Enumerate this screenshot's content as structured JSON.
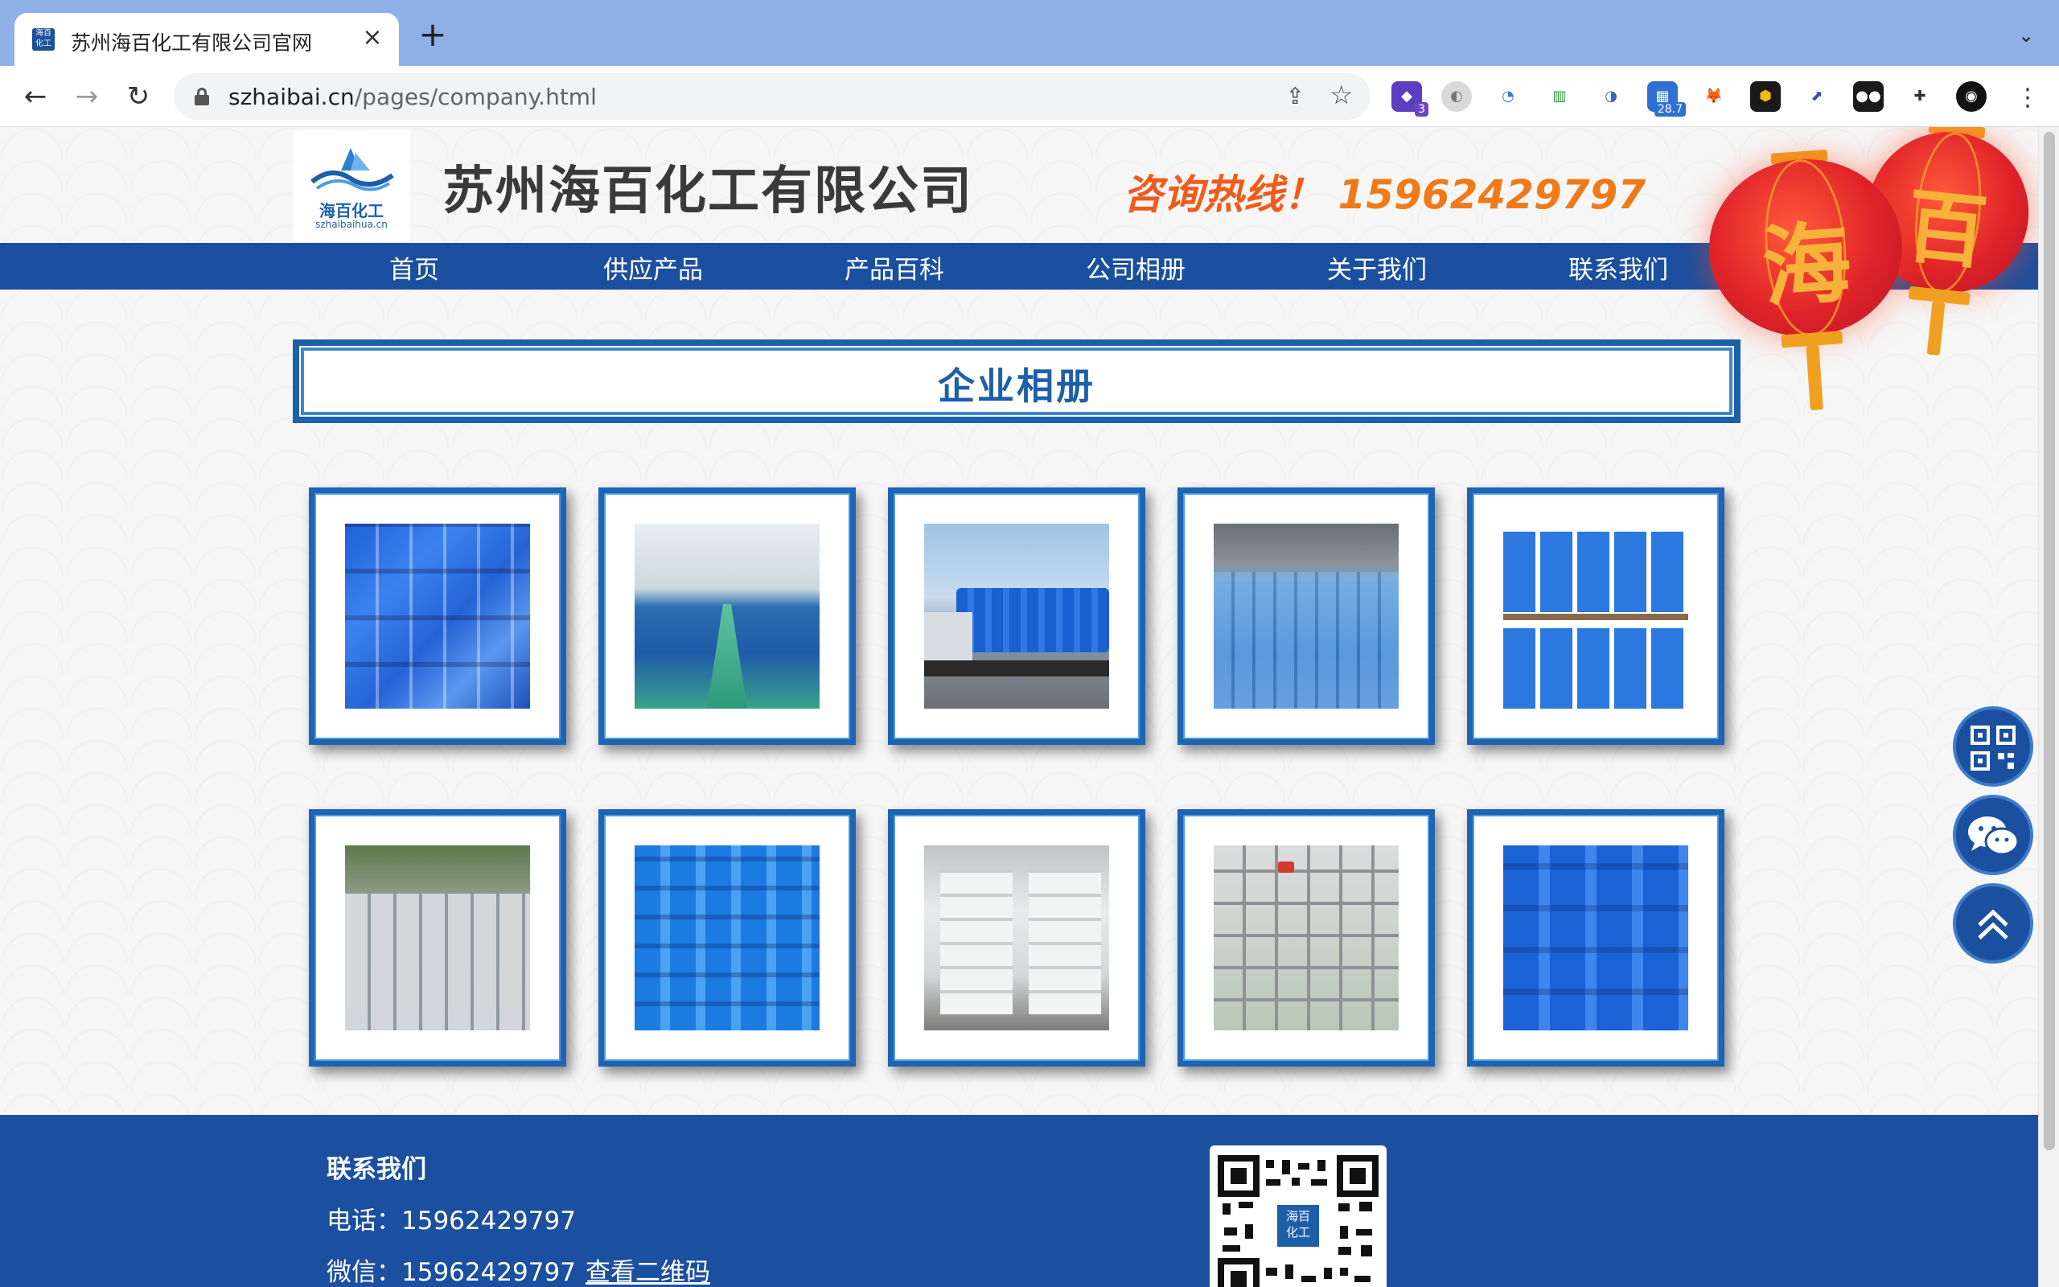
{
  "browser": {
    "tab_title": "苏州海百化工有限公司官网",
    "tab_favicon_text": "海百化工",
    "url_host": "szhaibai.cn",
    "url_path": "/pages/company.html",
    "extension_badge_count": "3",
    "extension_badge_value": "28.7"
  },
  "header": {
    "logo_text": "海百化工",
    "logo_sub": "szhaibaihua.cn",
    "company_name": "苏州海百化工有限公司",
    "hotline_label": "咨询热线！",
    "hotline_number": "15962429797"
  },
  "nav": {
    "items": [
      "首页",
      "供应产品",
      "产品百科",
      "公司相册",
      "关于我们",
      "联系我们"
    ]
  },
  "lanterns": [
    "海",
    "百"
  ],
  "section": {
    "title": "企业相册"
  },
  "gallery": {
    "photos": [
      {
        "name": "blue-jerrycans-stack"
      },
      {
        "name": "warehouse-aisle"
      },
      {
        "name": "truck-loaded-drums"
      },
      {
        "name": "drums-under-shed"
      },
      {
        "name": "drums-on-pallets"
      },
      {
        "name": "steel-drums"
      },
      {
        "name": "blue-jerrycans-rows"
      },
      {
        "name": "white-drums-pallets"
      },
      {
        "name": "ibc-tanks"
      },
      {
        "name": "blue-jerrycans-closeup"
      }
    ]
  },
  "footer": {
    "title": "联系我们",
    "phone_label": "电话：",
    "phone": "15962429797",
    "wechat_label": "微信：",
    "wechat": "15962429797",
    "qr_link": "查看二维码",
    "qr_center_text": "海百化工"
  },
  "colors": {
    "brand_blue": "#1b4f9f",
    "hotline_orange": "#f05a1a",
    "title_blue": "#1d5fa8"
  }
}
